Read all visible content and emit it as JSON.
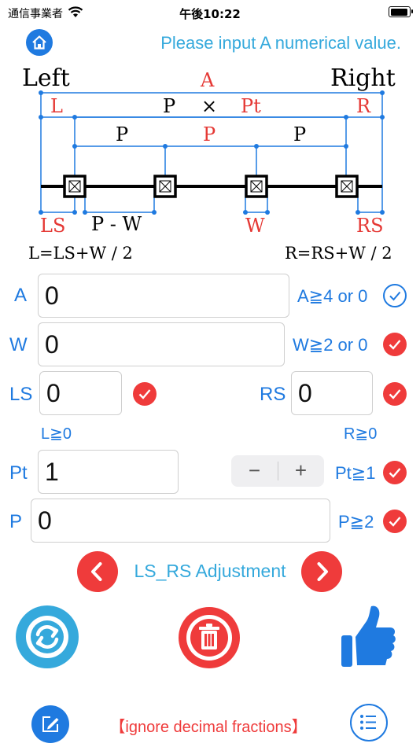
{
  "status": {
    "carrier": "通信事業者",
    "time": "午後10:22"
  },
  "header": {
    "prompt": "Please input A numerical value."
  },
  "diagram": {
    "left": "Left",
    "right": "Right",
    "a": "A",
    "l": "L",
    "p_times_pt": {
      "p": "P",
      "times": "×",
      "pt": "Pt"
    },
    "r": "R",
    "p_left": "P",
    "p_mid": "P",
    "p_right": "P",
    "ls": "LS",
    "p_minus_w": "P - W",
    "w": "W",
    "rs": "RS",
    "formula_l": "L=LS+W / 2",
    "formula_r": "R=RS+W / 2"
  },
  "form": {
    "a": {
      "label": "A",
      "value": "0",
      "cond": "A≧4 or 0"
    },
    "w": {
      "label": "W",
      "value": "0",
      "cond": "W≧2 or 0"
    },
    "ls": {
      "label": "LS",
      "value": "0"
    },
    "rs": {
      "label": "RS",
      "value": "0"
    },
    "l_cond": "L≧0",
    "r_cond": "R≧0",
    "pt": {
      "label": "Pt",
      "value": "1",
      "cond": "Pt≧1",
      "minus": "−",
      "plus": "+"
    },
    "p": {
      "label": "P",
      "value": "0",
      "cond": "P≧2"
    }
  },
  "adjust": {
    "label": "LS_RS Adjustment"
  },
  "footer": {
    "note": "【ignore decimal fractions】"
  },
  "colors": {
    "blue": "#1f7ae0",
    "light_blue": "#35a9dc",
    "red": "#ef3b3b"
  },
  "icons": [
    "wifi-icon",
    "battery-icon",
    "home-icon",
    "check-icon",
    "chevron-left-icon",
    "chevron-right-icon",
    "swap-icon",
    "trash-icon",
    "thumbs-up-icon",
    "edit-icon",
    "list-icon"
  ]
}
